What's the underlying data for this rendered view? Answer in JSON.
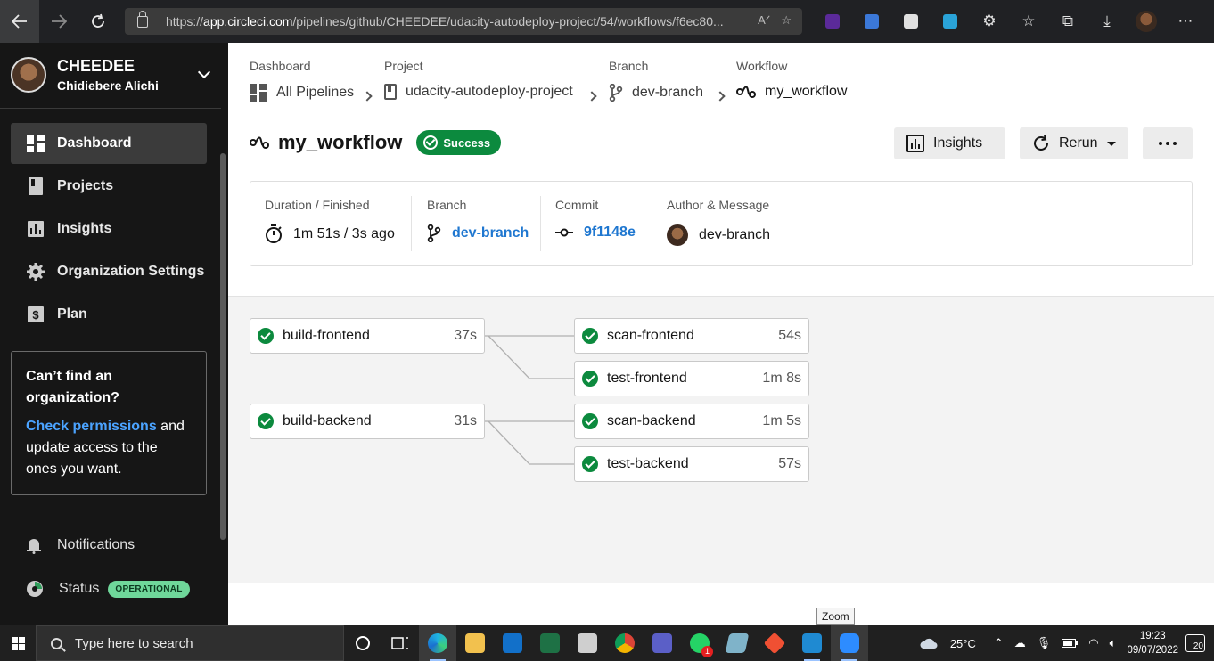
{
  "browser": {
    "url_prefix": "https://",
    "url_host": "app.circleci.com",
    "url_path": "/pipelines/github/CHEEDEE/udacity-autodeploy-project/54/workflows/f6ec80..."
  },
  "sidebar": {
    "org_name": "CHEEDEE",
    "user_name": "Chidiebere Alichi",
    "nav": [
      {
        "label": "Dashboard",
        "icon": "dashboard-icon"
      },
      {
        "label": "Projects",
        "icon": "projects-icon"
      },
      {
        "label": "Insights",
        "icon": "insights-icon"
      },
      {
        "label": "Organization Settings",
        "icon": "gear-icon"
      },
      {
        "label": "Plan",
        "icon": "dollar-icon"
      }
    ],
    "help": {
      "question": "Can’t find an organization?",
      "link": "Check permissions",
      "rest": " and update access to the ones you want."
    },
    "notifications_label": "Notifications",
    "status_label": "Status",
    "status_badge": "OPERATIONAL"
  },
  "breadcrumbs": [
    {
      "label": "Dashboard",
      "value": "All Pipelines"
    },
    {
      "label": "Project",
      "value": "udacity-autodeploy-project"
    },
    {
      "label": "Branch",
      "value": "dev-branch"
    },
    {
      "label": "Workflow",
      "value": "my_workflow"
    }
  ],
  "workflow": {
    "name": "my_workflow",
    "status": "Success",
    "insights_label": "Insights",
    "rerun_label": "Rerun"
  },
  "summary": {
    "duration_label": "Duration / Finished",
    "duration_value": "1m 51s / 3s ago",
    "branch_label": "Branch",
    "branch_value": "dev-branch",
    "commit_label": "Commit",
    "commit_value": "9f1148e",
    "author_label": "Author & Message",
    "author_value": "dev-branch"
  },
  "jobs": [
    {
      "name": "build-frontend",
      "duration": "37s"
    },
    {
      "name": "build-backend",
      "duration": "31s"
    },
    {
      "name": "scan-frontend",
      "duration": "54s"
    },
    {
      "name": "test-frontend",
      "duration": "1m 8s"
    },
    {
      "name": "scan-backend",
      "duration": "1m 5s"
    },
    {
      "name": "test-backend",
      "duration": "57s"
    }
  ],
  "tooltip": "Zoom",
  "taskbar": {
    "search_placeholder": "Type here to search",
    "temperature": "25°C",
    "time": "19:23",
    "date": "09/07/2022",
    "notification_count": "20",
    "whatsapp_badge": "1"
  },
  "colors": {
    "success": "#0c8a3e",
    "link": "#1f77d0",
    "sidebar_bg": "#161616"
  }
}
